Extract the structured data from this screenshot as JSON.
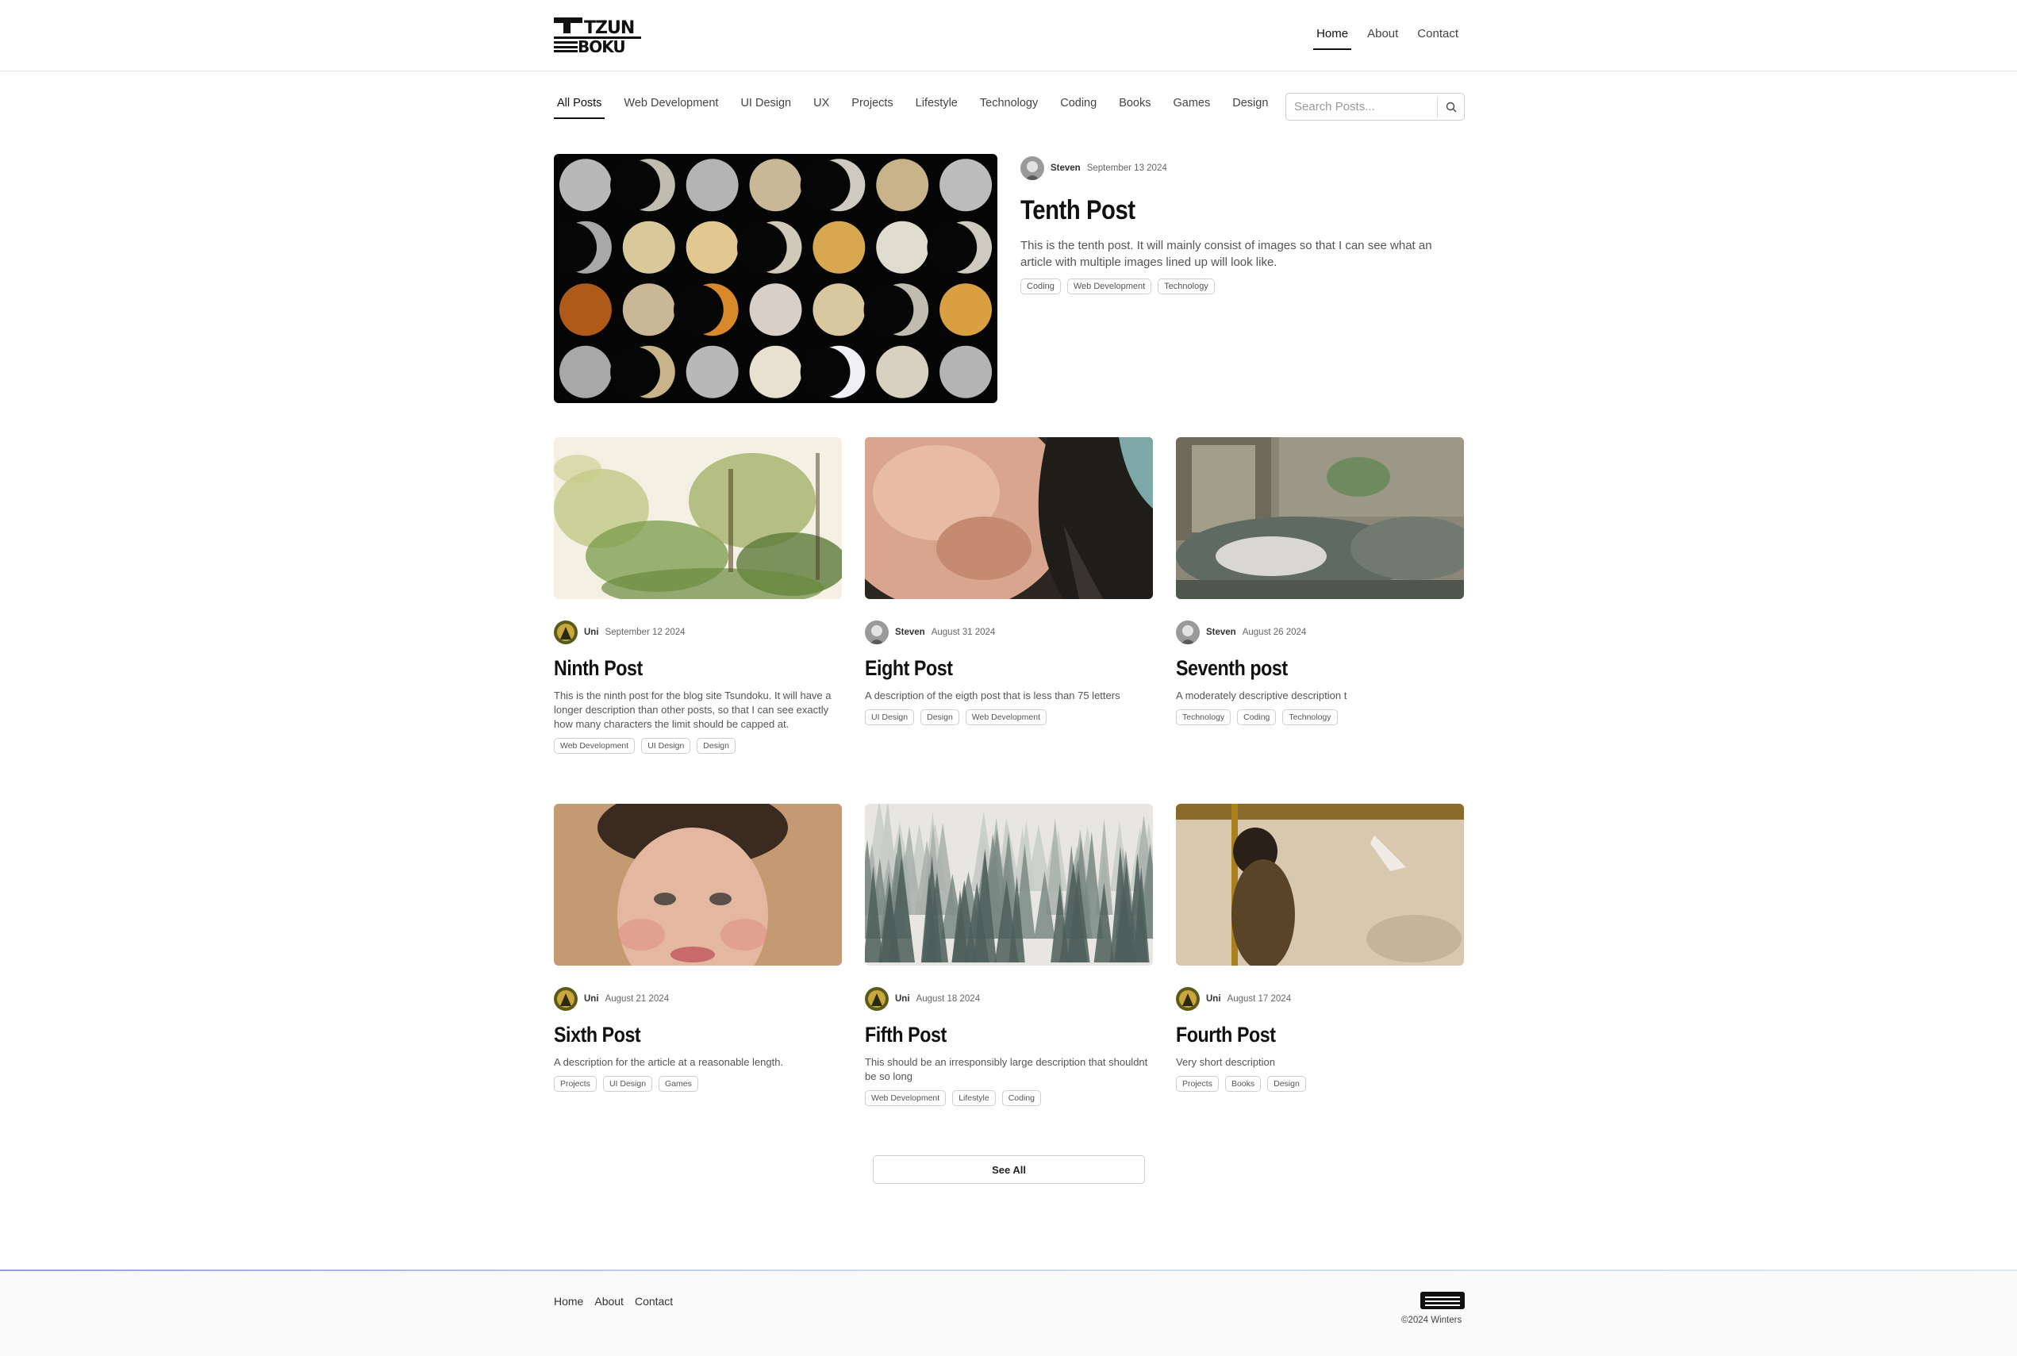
{
  "brand": {
    "logo_text_line1": "TZUN",
    "logo_text_line2": "BOKU"
  },
  "topnav": [
    {
      "label": "Home",
      "active": true
    },
    {
      "label": "About"
    },
    {
      "label": "Contact"
    }
  ],
  "categories": [
    {
      "label": "All Posts",
      "active": true
    },
    {
      "label": "Web Development"
    },
    {
      "label": "UI Design"
    },
    {
      "label": "UX"
    },
    {
      "label": "Projects"
    },
    {
      "label": "Lifestyle"
    },
    {
      "label": "Technology"
    },
    {
      "label": "Coding"
    },
    {
      "label": "Books"
    },
    {
      "label": "Games"
    },
    {
      "label": "Design"
    }
  ],
  "search": {
    "placeholder": "Search Posts...",
    "icon": "search-icon"
  },
  "featured": {
    "author": "Steven",
    "date": "September 13 2024",
    "title": "Tenth Post",
    "description": "This is the tenth post. It will mainly consist of images so that I can see what an article with multiple images lined up will look like.",
    "tags": [
      "Coding",
      "Web Development",
      "Technology"
    ],
    "image": "moon-phases-grid"
  },
  "posts": [
    {
      "author": "Uni",
      "date": "September 12 2024",
      "title": "Ninth Post",
      "description": "This is the ninth post for the blog site Tsundoku. It will have a longer description than other posts, so that I can see exactly how many characters the limit should be capped at.",
      "tags": [
        "Web Development",
        "UI Design",
        "Design"
      ],
      "image": "watercolor-jungle"
    },
    {
      "author": "Steven",
      "date": "August 31 2024",
      "title": "Eight Post",
      "description": "A description of the eigth post that is less than 75 letters",
      "tags": [
        "UI Design",
        "Design",
        "Web Development"
      ],
      "image": "pink-abstract-paint"
    },
    {
      "author": "Steven",
      "date": "August 26 2024",
      "title": "Seventh post",
      "description": "A moderately descriptive description t",
      "tags": [
        "Technology",
        "Coding",
        "Technology"
      ],
      "image": "surreal-sea-painting"
    },
    {
      "author": "Uni",
      "date": "August 21 2024",
      "title": "Sixth Post",
      "description": "A description for the article at a reasonable length.",
      "tags": [
        "Projects",
        "UI Design",
        "Games"
      ],
      "image": "pastel-portrait"
    },
    {
      "author": "Uni",
      "date": "August 18 2024",
      "title": "Fifth Post",
      "description": "This should be an irresponsibly large description that shouldnt be so long",
      "tags": [
        "Web Development",
        "Lifestyle",
        "Coding"
      ],
      "image": "misty-pine-forest"
    },
    {
      "author": "Uni",
      "date": "August 17 2024",
      "title": "Fourth Post",
      "description": "Very short description",
      "tags": [
        "Projects",
        "Books",
        "Design"
      ],
      "image": "figure-painting"
    }
  ],
  "see_all_label": "See All",
  "footer": {
    "links": [
      "Home",
      "About",
      "Contact"
    ],
    "copyright": "©2024 Winters"
  },
  "colors": {
    "text": "#111111",
    "muted": "#555555",
    "border": "#cfcfcf",
    "footer_bg": "#fafafa",
    "accent_line": "#9b9bd8"
  }
}
